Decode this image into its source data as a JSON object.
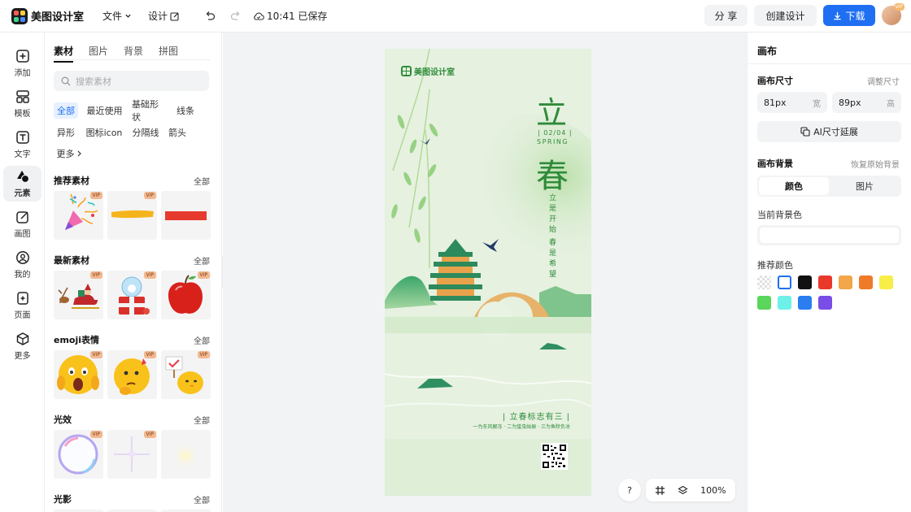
{
  "app": {
    "title": "美图设计室"
  },
  "header": {
    "menu_file": "文件",
    "menu_design": "设计",
    "saved_status": "10:41 已保存",
    "share_label": "分 享",
    "create_label": "创建设计",
    "download_label": "下载",
    "avatar_badge": "VIP"
  },
  "rail": [
    {
      "label": "添加",
      "icon": "plus-icon"
    },
    {
      "label": "模板",
      "icon": "template-icon"
    },
    {
      "label": "文字",
      "icon": "text-icon"
    },
    {
      "label": "元素",
      "icon": "shapes-icon"
    },
    {
      "label": "画图",
      "icon": "draw-icon"
    },
    {
      "label": "我的",
      "icon": "user-icon"
    },
    {
      "label": "页面",
      "icon": "page-icon"
    },
    {
      "label": "更多",
      "icon": "cube-icon"
    }
  ],
  "panel": {
    "tabs": [
      "素材",
      "图片",
      "背景",
      "拼图"
    ],
    "active_tab": "素材",
    "search_placeholder": "搜索素材",
    "chips": [
      "全部",
      "最近使用",
      "基础形状",
      "线条",
      "异形",
      "图标icon",
      "分隔线",
      "箭头",
      "更多"
    ],
    "active_chip": "全部",
    "see_all": "全部",
    "vip_badge": "VIP",
    "sections": [
      {
        "title": "推荐素材",
        "items": [
          "party-popper",
          "yellow-brush-stroke",
          "red-bar"
        ]
      },
      {
        "title": "最新素材",
        "items": [
          "santa-sleigh",
          "snow-globe-gift",
          "red-apple"
        ]
      },
      {
        "title": "emoji表情",
        "items": [
          "shocked-face",
          "thinking-face",
          "chick-with-sign"
        ]
      },
      {
        "title": "光效",
        "items": [
          "rainbow-bubble",
          "sparkle-star",
          "glow-orb"
        ]
      },
      {
        "title": "光影",
        "items": []
      }
    ]
  },
  "poster": {
    "brand": "美图设计室",
    "title_top": "立",
    "date": "| 02/04 |",
    "english": "SPRING",
    "title_bottom": "春",
    "vertical_left": "立是开始",
    "vertical_right": "春是希望",
    "footer_title": "| 立春标志有三 |",
    "footer_line": "一为东风解冻 · 二为蛰虫始振 · 三为鱼陟负冰"
  },
  "zoom": {
    "help": "?",
    "level": "100%"
  },
  "right": {
    "title": "画布",
    "size_label": "画布尺寸",
    "size_action": "调整尺寸",
    "width_value": "81px",
    "width_unit": "宽",
    "height_value": "89px",
    "height_unit": "高",
    "ai_button": "AI尺寸延展",
    "bg_label": "画布背景",
    "bg_action": "恢复原始背景",
    "seg_color": "颜色",
    "seg_image": "图片",
    "current_bg_label": "当前背景色",
    "current_bg_value": "#ffffff",
    "recommended_label": "推荐颜色",
    "swatches": [
      "transparent",
      "#ffffff",
      "#111111",
      "#e8392b",
      "#f2a74a",
      "#ef7a28",
      "#f7ee48",
      "#5ad65a",
      "#6df0e8",
      "#2b7ef0",
      "#7a4de8"
    ]
  }
}
